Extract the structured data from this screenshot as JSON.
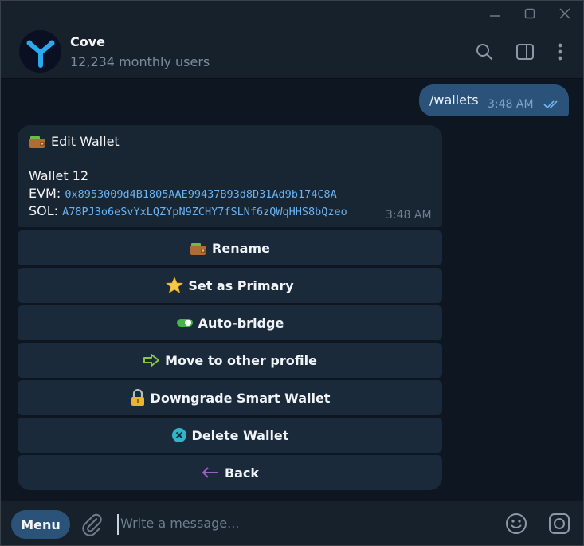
{
  "chat": {
    "title": "Cove",
    "subtitle": "12,234 monthly users"
  },
  "outgoing": {
    "text": "/wallets",
    "time": "3:48 AM"
  },
  "incoming": {
    "title": "Edit Wallet",
    "name": "Wallet 12",
    "evm_label": "EVM: ",
    "evm_address": "0x8953009d4B1805AAE99437B93d8D31Ad9b174C8A",
    "sol_label": "SOL: ",
    "sol_address": "A78PJ3o6eSvYxLQZYpN9ZCHY7fSLNf6zQWqHHS8bQzeo",
    "time": "3:48 AM"
  },
  "keyboard": [
    {
      "label": "Rename",
      "icon": "wallet-icon"
    },
    {
      "label": "Set as Primary",
      "icon": "star-icon"
    },
    {
      "label": "Auto-bridge",
      "icon": "toggle-icon"
    },
    {
      "label": "Move to other profile",
      "icon": "arrow-right-icon"
    },
    {
      "label": "Downgrade Smart Wallet",
      "icon": "lock-icon"
    },
    {
      "label": "Delete Wallet",
      "icon": "cross-icon"
    },
    {
      "label": "Back",
      "icon": "arrow-left-icon"
    }
  ],
  "composer": {
    "menu_label": "Menu",
    "placeholder": "Write a message..."
  },
  "colors": {
    "background": "#0e1621",
    "panel": "#17212b",
    "outgoing_bubble": "#2b5278",
    "incoming_bubble": "#182533",
    "button": "#1b2a3a",
    "link": "#6ab2f2"
  }
}
